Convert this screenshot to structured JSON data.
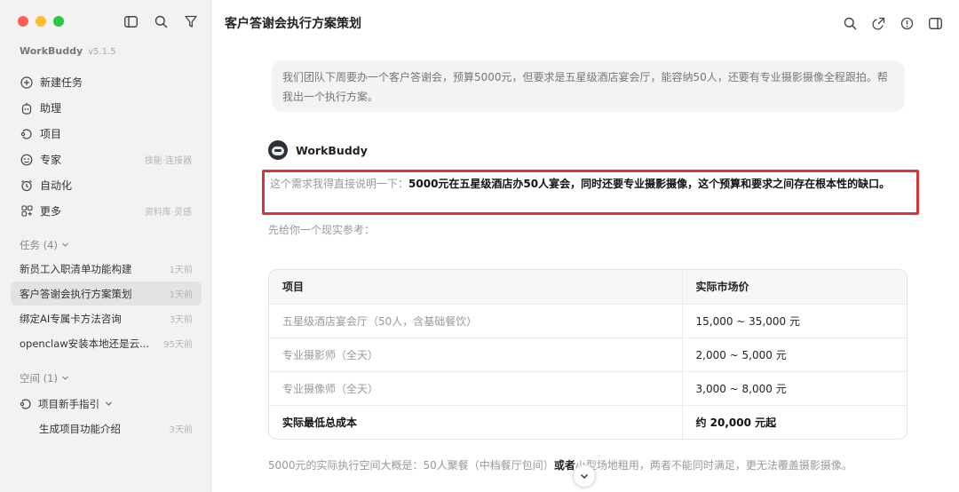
{
  "sidebar": {
    "brand": "WorkBuddy",
    "version": "v5.1.5",
    "menu": [
      {
        "label": "新建任务",
        "icon": "plus-circle-icon",
        "hint": ""
      },
      {
        "label": "助理",
        "icon": "assistant-icon",
        "hint": ""
      },
      {
        "label": "项目",
        "icon": "project-icon",
        "hint": ""
      },
      {
        "label": "专家",
        "icon": "expert-icon",
        "hint": "技能·连接器"
      },
      {
        "label": "自动化",
        "icon": "alarm-icon",
        "hint": ""
      },
      {
        "label": "更多",
        "icon": "grid-icon",
        "hint": "资料库·灵感"
      }
    ],
    "tasks_header": "任务 (4)",
    "tasks": [
      {
        "name": "新员工入职清单功能构建",
        "date": "1天前"
      },
      {
        "name": "客户答谢会执行方案策划",
        "date": "1天前"
      },
      {
        "name": "绑定AI专属卡方法咨询",
        "date": "3天前"
      },
      {
        "name": "openclaw安装本地还是云...",
        "date": "95天前"
      }
    ],
    "space_header": "空间 (1)",
    "space_item": "项目新手指引",
    "space_sub": {
      "name": "生成项目功能介绍",
      "date": "3天前"
    }
  },
  "main": {
    "title": "客户答谢会执行方案策划",
    "user_message": "我们团队下周要办一个客户答谢会，预算5000元，但要求是五星级酒店宴会厅，能容纳50人，还要有专业摄影摄像全程跟拍。帮我出一个执行方案。",
    "bot_name": "WorkBuddy",
    "reply_intro": "这个需求我得直接说明一下：",
    "reply_bold": "5000元在五星级酒店办50人宴会，同时还要专业摄影摄像，这个预算和要求之间存在根本性的缺口。",
    "reference_line": "先给你一个现实参考：",
    "table": {
      "headers": [
        "项目",
        "实际市场价"
      ],
      "rows": [
        [
          "五星级酒店宴会厅（50人，含基础餐饮）",
          "15,000 ~ 35,000 元"
        ],
        [
          "专业摄影师（全天）",
          "2,000 ~ 5,000 元"
        ],
        [
          "专业摄像师（全天）",
          "3,000 ~ 8,000 元"
        ]
      ],
      "total": [
        "实际最低总成本",
        "约 20,000 元起"
      ]
    },
    "bottom_pre": "5000元的实际执行空间大概是：50人聚餐（中档餐厅包间）",
    "bottom_bold": "或者",
    "bottom_post": "小型场地租用，两者不能同时满足，更无法覆盖摄影摄像。"
  }
}
